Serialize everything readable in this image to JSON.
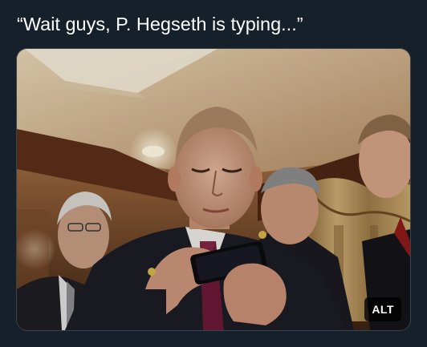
{
  "post": {
    "text": "“Wait guys, P. Hegseth is typing...”"
  },
  "media": {
    "alt_badge_label": "ALT"
  },
  "colors": {
    "background": "#15202b",
    "text": "#ffffff",
    "media_border": "#38444d",
    "badge_bg": "#000000"
  }
}
